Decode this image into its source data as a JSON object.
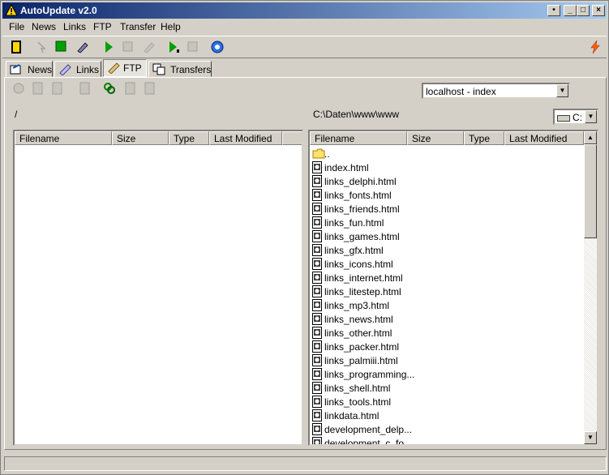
{
  "window": {
    "title": "AutoUpdate v2.0"
  },
  "caption_buttons": {
    "pin": "•",
    "minimize": "_",
    "maximize": "□",
    "close": "×"
  },
  "menu": [
    "File",
    "News",
    "Links",
    "FTP",
    "Transfer",
    "Help"
  ],
  "tabs": [
    {
      "label": "News",
      "icon": "news-icon"
    },
    {
      "label": "Links",
      "icon": "links-icon"
    },
    {
      "label": "FTP",
      "icon": "ftp-icon",
      "active": true
    },
    {
      "label": "Transfers",
      "icon": "transfers-icon"
    }
  ],
  "ftp": {
    "site_select": "localhost - index",
    "remote_path": "/",
    "local_path": "C:\\Daten\\www\\www",
    "drive": "C:"
  },
  "remote_list": {
    "headers": [
      "Filename",
      "Size",
      "Type",
      "Last Modified"
    ],
    "rows": []
  },
  "local_list": {
    "headers": [
      "Filename",
      "Size",
      "Type",
      "Last Modified"
    ],
    "rows": [
      {
        "name": "..",
        "kind": "folder"
      },
      {
        "name": "index.html",
        "kind": "file"
      },
      {
        "name": "links_delphi.html",
        "kind": "file"
      },
      {
        "name": "links_fonts.html",
        "kind": "file"
      },
      {
        "name": "links_friends.html",
        "kind": "file"
      },
      {
        "name": "links_fun.html",
        "kind": "file"
      },
      {
        "name": "links_games.html",
        "kind": "file"
      },
      {
        "name": "links_gfx.html",
        "kind": "file"
      },
      {
        "name": "links_icons.html",
        "kind": "file"
      },
      {
        "name": "links_internet.html",
        "kind": "file"
      },
      {
        "name": "links_litestep.html",
        "kind": "file"
      },
      {
        "name": "links_mp3.html",
        "kind": "file"
      },
      {
        "name": "links_news.html",
        "kind": "file"
      },
      {
        "name": "links_other.html",
        "kind": "file"
      },
      {
        "name": "links_packer.html",
        "kind": "file"
      },
      {
        "name": "links_palmiii.html",
        "kind": "file"
      },
      {
        "name": "links_programming...",
        "kind": "file"
      },
      {
        "name": "links_shell.html",
        "kind": "file"
      },
      {
        "name": "links_tools.html",
        "kind": "file"
      },
      {
        "name": "linkdata.html",
        "kind": "file"
      },
      {
        "name": "development_delp...",
        "kind": "file"
      },
      {
        "name": "development_c_fo...",
        "kind": "file"
      }
    ]
  },
  "colors": {
    "titlebar_start": "#0a246a",
    "titlebar_end": "#a6caf0",
    "face": "#d4d0c8"
  }
}
